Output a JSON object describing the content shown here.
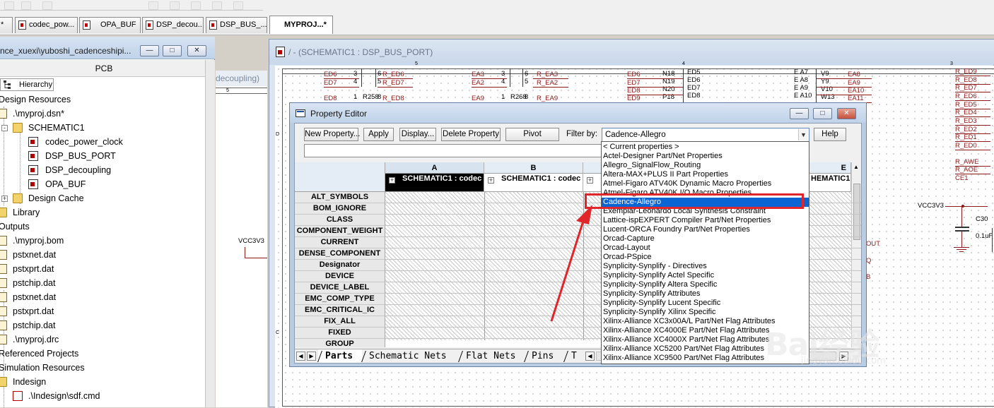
{
  "tabs": [
    {
      "label": "*"
    },
    {
      "label": "codec_pow..."
    },
    {
      "label": "OPA_BUF"
    },
    {
      "label": "DSP_decou..."
    },
    {
      "label": "DSP_BUS_..."
    },
    {
      "label": "MYPROJ...*"
    }
  ],
  "project_panel": {
    "title": "nce_xuexi\\yuboshi_cadenceshipi...",
    "section_label": "PCB",
    "hierarchy_tab": "Hierarchy",
    "tree": [
      {
        "label": "Design Resources"
      },
      {
        "label": ".\\myproj.dsn*"
      },
      {
        "label": "SCHEMATIC1"
      },
      {
        "label": "codec_power_clock"
      },
      {
        "label": "DSP_BUS_PORT"
      },
      {
        "label": "DSP_decoupling"
      },
      {
        "label": "OPA_BUF"
      },
      {
        "label": "Design Cache"
      },
      {
        "label": "Library"
      },
      {
        "label": "Outputs"
      },
      {
        "label": ".\\myproj.bom"
      },
      {
        "label": "pstxnet.dat"
      },
      {
        "label": "pstxprt.dat"
      },
      {
        "label": "pstchip.dat"
      },
      {
        "label": "pstxnet.dat"
      },
      {
        "label": "pstxprt.dat"
      },
      {
        "label": "pstchip.dat"
      },
      {
        "label": ".\\myproj.drc"
      },
      {
        "label": "Referenced Projects"
      },
      {
        "label": "Simulation Resources"
      },
      {
        "label": "Indesign"
      },
      {
        "label": ".\\Indesign\\sdf.cmd"
      }
    ]
  },
  "middle_window": {
    "title": "decoupling)"
  },
  "schematic_window": {
    "title": "/ - (SCHEMATIC1 : DSP_BUS_PORT)",
    "labels": {
      "vcc_left": "VCC3V3",
      "vcc_right": "VCC3V3",
      "c30": "C30",
      "c30_val": "0.1uF",
      "out": "OUT",
      "q": "Q",
      "b": "B",
      "col5": "5",
      "col4": "4",
      "col3": "3",
      "row_d": "D",
      "row_c": "C",
      "r258": "R258",
      "r268": "R268"
    },
    "nets_col1": [
      "ED6",
      "ED7",
      "ED8"
    ],
    "nets_col1_r": [
      "R_ED6",
      "R_ED7",
      "R_ED8"
    ],
    "pins_col1": [
      "3",
      "4",
      "1"
    ],
    "pins_col1_r": [
      "6",
      "5",
      "8"
    ],
    "nets_col2": [
      "EA3",
      "EA2",
      "EA9"
    ],
    "nets_col2_r": [
      "R_EA3",
      "R_EA2",
      "R_EA9"
    ],
    "pins_col2": [
      "3",
      "4",
      "1"
    ],
    "pins_col2_r": [
      "6",
      "5",
      "8"
    ],
    "nets_col3": [
      "ED6",
      "ED7",
      "ED8",
      "ED9"
    ],
    "pins_col3": [
      "N18",
      "N19",
      "N20",
      "P18"
    ],
    "pins_col3_r": [
      "ED5",
      "ED6",
      "ED7",
      "ED8"
    ],
    "nets_col4": [
      "E A7",
      "E A8",
      "E A9",
      "E A10"
    ],
    "pins_col4": [
      "V9",
      "Y9",
      "V10",
      "W13"
    ],
    "nets_col4_r": [
      "EA8",
      "EA9",
      "EA10",
      "EA11"
    ],
    "nets_right": [
      "R_ED9",
      "R_ED8",
      "R_ED7",
      "R_ED6",
      "R_ED5",
      "R_ED4",
      "R_ED3",
      "R_ED2",
      "R_ED1",
      "R_ED0"
    ],
    "nets_right2": [
      "R_AWE",
      "R_AOE",
      "CE1"
    ]
  },
  "property_editor": {
    "title": "Property Editor",
    "buttons": {
      "new_property": "New Property...",
      "apply": "Apply",
      "display": "Display...",
      "delete_property": "Delete Property",
      "pivot": "Pivot",
      "help": "Help"
    },
    "filter_label": "Filter by:",
    "filter_value": "Cadence-Allegro",
    "column_letters": [
      "A",
      "B",
      "E"
    ],
    "column_subheaders": [
      "SCHEMATIC1 : codec",
      "SCHEMATIC1 : codec",
      "HEMATIC1"
    ],
    "rows": [
      "ALT_SYMBOLS",
      "BOM_IGNORE",
      "CLASS",
      "COMPONENT_WEIGHT",
      "CURRENT",
      "DENSE_COMPONENT",
      "Designator",
      "DEVICE",
      "DEVICE_LABEL",
      "EMC_COMP_TYPE",
      "EMC_CRITICAL_IC",
      "FIX_ALL",
      "FIXED",
      "GROUP"
    ],
    "sheet_tabs": [
      "Parts",
      "Schematic Nets",
      "Flat Nets",
      "Pins",
      "T"
    ]
  },
  "filter_dropdown": {
    "options": [
      "< Current properties >",
      "Actel-Designer Part/Net Properties",
      "Allegro_SignalFlow_Routing",
      "Altera-MAX+PLUS II Part Properties",
      "Atmel-Figaro ATV40K Dynamic Macro Properties",
      "Atmel-Figaro ATV40K I/O Macro Properties",
      "Cadence-Allegro",
      "Exemplar-Leonardo Local Synthesis Constraint",
      "Lattice-ispEXPERT Compiler Part/Net Properties",
      "Lucent-ORCA Foundry Part/Net Properties",
      "Orcad-Capture",
      "Orcad-Layout",
      "Orcad-PSpice",
      "Synplicity-Synplify - Directives",
      "Synplicity-Synplify Actel Specific",
      "Synplicity-Synplify Altera Specific",
      "Synplicity-Synplify Attributes",
      "Synplicity-Synplify Lucent Specific",
      "Synplicity-Synplify Xilinx Specific",
      "Xilinx-Alliance XC3x00A/L Part/Net Flag Attributes",
      "Xilinx-Alliance XC4000E Part/Net Flag Attributes",
      "Xilinx-Alliance XC4000X Part/Net Flag Attributes",
      "Xilinx-Alliance XC5200 Part/Net Flag Attributes",
      "Xilinx-Alliance XC9500 Part/Net Flag Attributes"
    ],
    "selected_index": 6
  },
  "watermark": {
    "text": "Bai经验",
    "sub": "jingyan.baidu.com"
  },
  "colors": {
    "highlight": "#e0262a",
    "selection": "#0a64d4",
    "net": "#8b1a1a"
  }
}
